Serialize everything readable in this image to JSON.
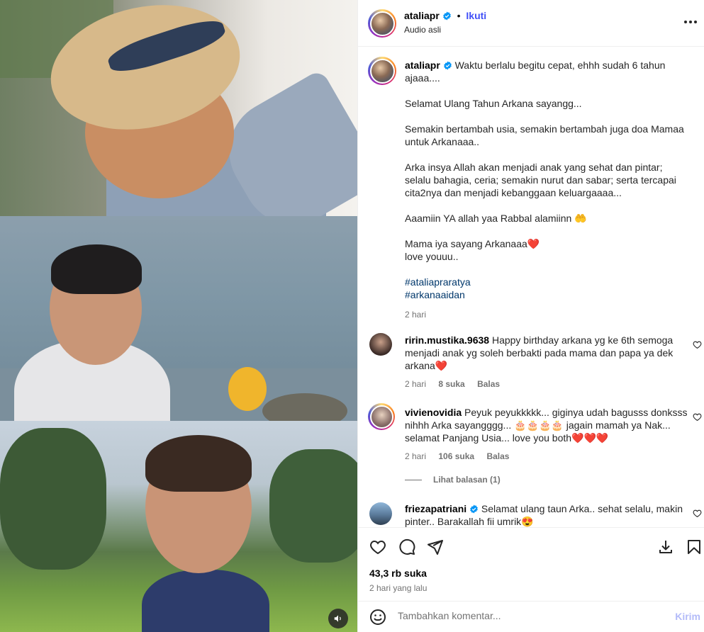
{
  "post": {
    "username": "ataliapr",
    "follow_label": "Ikuti",
    "separator": "•",
    "audio_label": "Audio asli"
  },
  "caption": {
    "username": "ataliapr",
    "lines": [
      "Waktu berlalu begitu cepat, ehhh sudah 6 tahun ajaaa....",
      "Selamat Ulang Tahun Arkana sayangg...",
      "Semakin bertambah usia, semakin bertambah juga doa Mamaa untuk Arkanaaa..",
      "Arka insya Allah akan menjadi anak yang sehat dan pintar; selalu bahagia, ceria; semakin nurut dan sabar; serta tercapai cita2nya dan menjadi kebanggaan keluargaaaa...",
      "Aaamiin YA allah yaa Rabbal alamiinn 🤲",
      "Mama iya sayang Arkanaaa❤️",
      "love youuu.."
    ],
    "hashtags": [
      "#ataliapraratya",
      "#arkanaaidan"
    ],
    "time": "2 hari"
  },
  "comments": [
    {
      "username": "ririn.mustika.9638",
      "text": "Happy birthday arkana yg ke 6th semoga menjadi anak yg soleh berbakti pada mama dan papa ya dek arkana❤️",
      "time": "2 hari",
      "likes": "8 suka",
      "reply": "Balas"
    },
    {
      "username": "vivienovidia",
      "text": "Peyuk peyukkkkk... giginya udah bagusss donksss nihhh Arka sayangggg... 🎂🎂🎂🎂 jagain mamah ya Nak... selamat Panjang Usia... love you both❤️❤️❤️",
      "time": "2 hari",
      "likes": "106 suka",
      "reply": "Balas"
    },
    {
      "username": "friezapatriani",
      "text": "Selamat ulang taun Arka.. sehat selalu, makin pinter.. Barakallah fii umrik😍"
    }
  ],
  "view_replies": "Lihat balasan (1)",
  "stats": {
    "likes": "43,3 rb suka",
    "time_ago": "2 hari yang lalu"
  },
  "comment_box": {
    "placeholder": "Tambahkan komentar...",
    "post_label": "Kirim"
  },
  "icons": [
    "heart-icon",
    "comment-icon",
    "share-icon",
    "save-icon",
    "bookmark-icon",
    "emoji-icon",
    "more-icon",
    "audio-icon",
    "verified-icon"
  ],
  "colors": {
    "follow_blue": "#4150f7",
    "verified_blue": "#0095f6",
    "hashtag": "#00376b",
    "muted": "#737373",
    "post_disabled": "#b3bbf9",
    "heart_red": "#e0245e"
  }
}
